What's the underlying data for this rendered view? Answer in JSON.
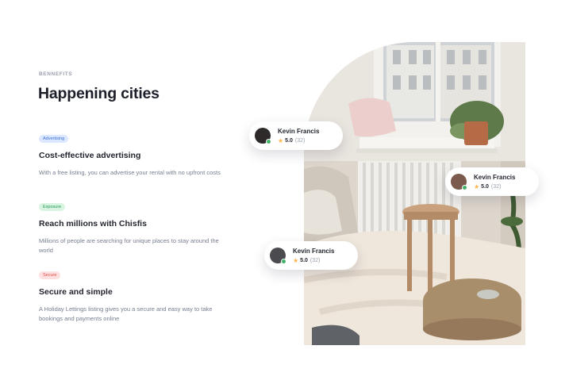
{
  "section": {
    "eyebrow": "BENNEFITS",
    "title": "Happening cities"
  },
  "benefits": [
    {
      "tag": "Advertising",
      "title": "Cost-effective advertising",
      "description": "With a free listing, you can advertise your rental with no upfront costs"
    },
    {
      "tag": "Exposure",
      "title": "Reach millions with Chisfis",
      "description": "Millions of people are searching for unique places to stay around the world"
    },
    {
      "tag": "Secure",
      "title": "Secure and simple",
      "description": "A Holiday Lettings listing gives you a secure and easy way to take bookings and payments online"
    }
  ],
  "reviews": [
    {
      "name": "Kevin Francis",
      "rating": "5.0",
      "count": "(32)"
    },
    {
      "name": "Kevin Francis",
      "rating": "5.0",
      "count": "(32)"
    },
    {
      "name": "Kevin Francis",
      "rating": "5.0",
      "count": "(32)"
    }
  ],
  "colors": {
    "accent_blue": "#3b6fd4",
    "accent_green": "#27995a",
    "accent_red": "#d94f4f",
    "online_dot": "#45b26b",
    "star": "#ffb547"
  },
  "icons": {
    "rating": "star-icon",
    "status": "online-dot"
  }
}
